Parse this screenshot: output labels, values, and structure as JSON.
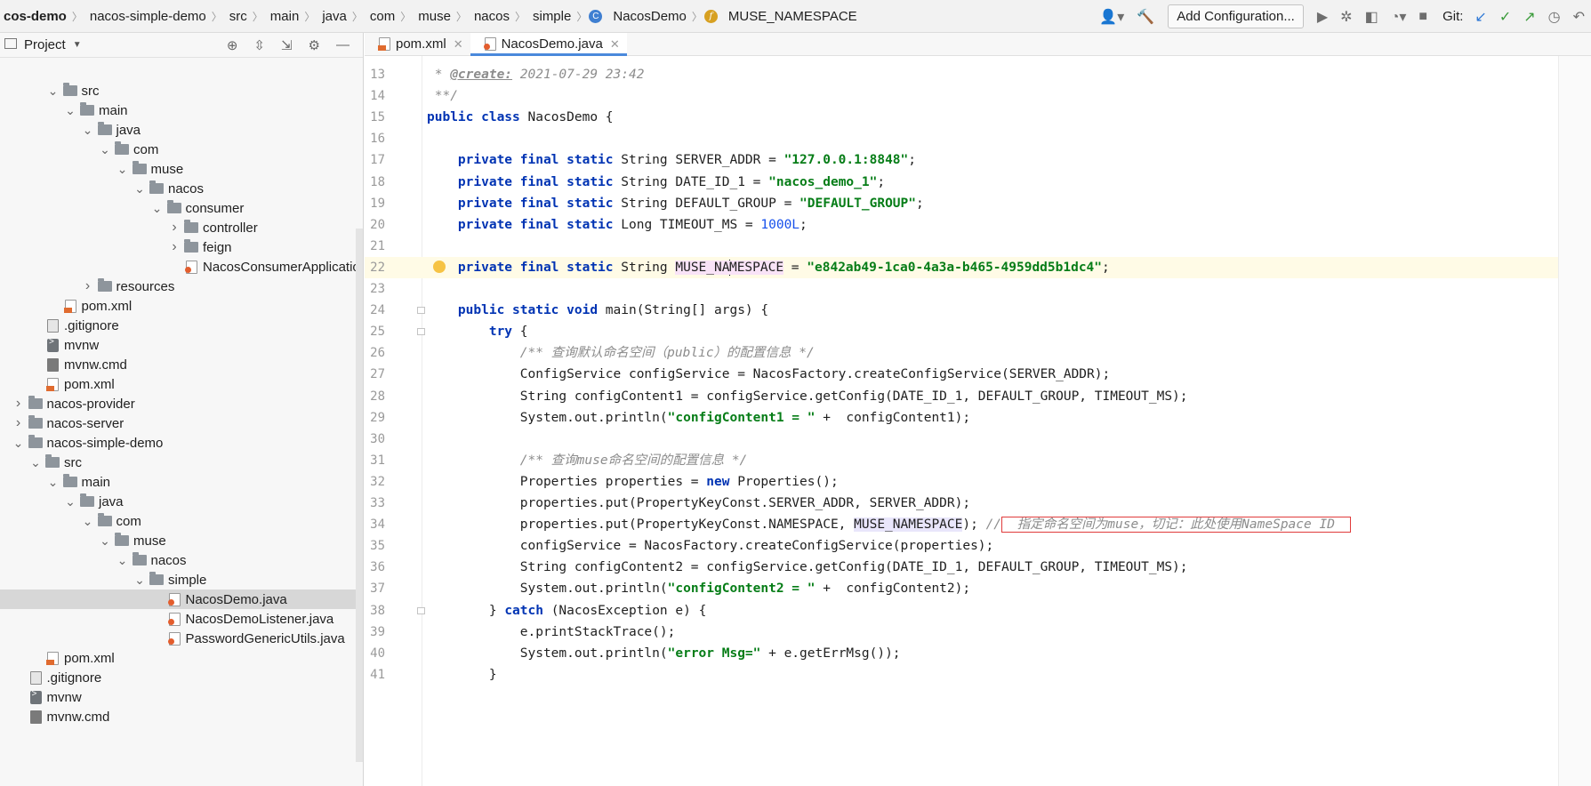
{
  "breadcrumbs": [
    {
      "label": "cos-demo"
    },
    {
      "label": "nacos-simple-demo"
    },
    {
      "label": "src"
    },
    {
      "label": "main"
    },
    {
      "label": "java"
    },
    {
      "label": "com"
    },
    {
      "label": "muse"
    },
    {
      "label": "nacos"
    },
    {
      "label": "simple"
    },
    {
      "label": "NacosDemo"
    },
    {
      "label": "MUSE_NAMESPACE"
    }
  ],
  "toolbar": {
    "add_config_label": "Add Configuration...",
    "git_label": "Git:"
  },
  "project": {
    "title": "Project"
  },
  "tree": [
    {
      "label": "src",
      "depth": 3,
      "type": "folder",
      "expanded": true
    },
    {
      "label": "main",
      "depth": 4,
      "type": "folder",
      "expanded": true
    },
    {
      "label": "java",
      "depth": 5,
      "type": "folder",
      "expanded": true
    },
    {
      "label": "com",
      "depth": 6,
      "type": "folder",
      "expanded": true
    },
    {
      "label": "muse",
      "depth": 7,
      "type": "folder",
      "expanded": true
    },
    {
      "label": "nacos",
      "depth": 8,
      "type": "folder",
      "expanded": true
    },
    {
      "label": "consumer",
      "depth": 9,
      "type": "folder",
      "expanded": true
    },
    {
      "label": "controller",
      "depth": 10,
      "type": "folder",
      "expanded": false
    },
    {
      "label": "feign",
      "depth": 10,
      "type": "folder",
      "expanded": false
    },
    {
      "label": "NacosConsumerApplicatio",
      "depth": 10,
      "type": "java"
    },
    {
      "label": "resources",
      "depth": 5,
      "type": "folder",
      "expanded": false
    },
    {
      "label": "pom.xml",
      "depth": 3,
      "type": "xml"
    },
    {
      "label": ".gitignore",
      "depth": 2,
      "type": "gen"
    },
    {
      "label": "mvnw",
      "depth": 2,
      "type": "term"
    },
    {
      "label": "mvnw.cmd",
      "depth": 2,
      "type": "cmd"
    },
    {
      "label": "pom.xml",
      "depth": 2,
      "type": "xml"
    },
    {
      "label": "nacos-provider",
      "depth": 1,
      "type": "folder",
      "expanded": false
    },
    {
      "label": "nacos-server",
      "depth": 1,
      "type": "folder",
      "expanded": false
    },
    {
      "label": "nacos-simple-demo",
      "depth": 1,
      "type": "folder",
      "expanded": true
    },
    {
      "label": "src",
      "depth": 2,
      "type": "folder",
      "expanded": true
    },
    {
      "label": "main",
      "depth": 3,
      "type": "folder",
      "expanded": true
    },
    {
      "label": "java",
      "depth": 4,
      "type": "folder",
      "expanded": true
    },
    {
      "label": "com",
      "depth": 5,
      "type": "folder",
      "expanded": true
    },
    {
      "label": "muse",
      "depth": 6,
      "type": "folder",
      "expanded": true
    },
    {
      "label": "nacos",
      "depth": 7,
      "type": "folder",
      "expanded": true
    },
    {
      "label": "simple",
      "depth": 8,
      "type": "folder",
      "expanded": true
    },
    {
      "label": "NacosDemo.java",
      "depth": 9,
      "type": "java",
      "selected": true
    },
    {
      "label": "NacosDemoListener.java",
      "depth": 9,
      "type": "java"
    },
    {
      "label": "PasswordGenericUtils.java",
      "depth": 9,
      "type": "java"
    },
    {
      "label": "pom.xml",
      "depth": 2,
      "type": "xml"
    },
    {
      "label": ".gitignore",
      "depth": 1,
      "type": "gen"
    },
    {
      "label": "mvnw",
      "depth": 1,
      "type": "term"
    },
    {
      "label": "mvnw.cmd",
      "depth": 1,
      "type": "cmd"
    }
  ],
  "tabs": [
    {
      "label": "pom.xml",
      "active": false
    },
    {
      "label": "NacosDemo.java",
      "active": true
    }
  ],
  "code_lines": [
    {
      "n": "13",
      "segs": [
        [
          " * ",
          "cm"
        ],
        [
          "@create:",
          "doc-tag"
        ],
        [
          " 2021-07-29 23:42",
          "cm"
        ]
      ]
    },
    {
      "n": "14",
      "segs": [
        [
          " **/",
          "cm"
        ]
      ]
    },
    {
      "n": "15",
      "segs": [
        [
          "public class ",
          "kw"
        ],
        [
          "NacosDemo {",
          ""
        ]
      ]
    },
    {
      "n": "16",
      "segs": []
    },
    {
      "n": "17",
      "segs": [
        [
          "    ",
          ""
        ],
        [
          "private final static ",
          "kw"
        ],
        [
          "String SERVER_ADDR = ",
          ""
        ],
        [
          "\"127.0.0.1:8848\"",
          "str"
        ],
        [
          ";",
          ""
        ]
      ]
    },
    {
      "n": "18",
      "segs": [
        [
          "    ",
          ""
        ],
        [
          "private final static ",
          "kw"
        ],
        [
          "String DATE_ID_1 = ",
          ""
        ],
        [
          "\"nacos_demo_1\"",
          "str"
        ],
        [
          ";",
          ""
        ]
      ]
    },
    {
      "n": "19",
      "segs": [
        [
          "    ",
          ""
        ],
        [
          "private final static ",
          "kw"
        ],
        [
          "String DEFAULT_GROUP = ",
          ""
        ],
        [
          "\"DEFAULT_GROUP\"",
          "str"
        ],
        [
          ";",
          ""
        ]
      ]
    },
    {
      "n": "20",
      "segs": [
        [
          "    ",
          ""
        ],
        [
          "private final static ",
          "kw"
        ],
        [
          "Long TIMEOUT_MS = ",
          ""
        ],
        [
          "1000L",
          "num"
        ],
        [
          ";",
          ""
        ]
      ]
    },
    {
      "n": "21",
      "segs": []
    },
    {
      "n": "22",
      "current": true,
      "bulb": true,
      "segs": [
        [
          "    ",
          ""
        ],
        [
          "private final static ",
          "kw"
        ],
        [
          "String ",
          ""
        ],
        [
          "MUSE_NA",
          "hl-def"
        ],
        [
          "|",
          "caret"
        ],
        [
          "MESPACE",
          "hl-def"
        ],
        [
          " = ",
          ""
        ],
        [
          "\"e842ab49-1ca0-4a3a-b465-4959dd5b1dc4\"",
          "str"
        ],
        [
          ";",
          ""
        ]
      ]
    },
    {
      "n": "23",
      "segs": []
    },
    {
      "n": "24",
      "fold": true,
      "segs": [
        [
          "    ",
          ""
        ],
        [
          "public static void ",
          "kw"
        ],
        [
          "main(String[] args) {",
          ""
        ]
      ]
    },
    {
      "n": "25",
      "fold": true,
      "segs": [
        [
          "        ",
          ""
        ],
        [
          "try ",
          "kw"
        ],
        [
          "{",
          ""
        ]
      ]
    },
    {
      "n": "26",
      "segs": [
        [
          "            ",
          ""
        ],
        [
          "/** 查询默认命名空间（public）的配置信息 */",
          "cm"
        ]
      ]
    },
    {
      "n": "27",
      "segs": [
        [
          "            ConfigService configService = NacosFactory.createConfigService(SERVER_ADDR);",
          ""
        ]
      ]
    },
    {
      "n": "28",
      "segs": [
        [
          "            String configContent1 = configService.getConfig(DATE_ID_1, DEFAULT_GROUP, TIMEOUT_MS);",
          ""
        ]
      ]
    },
    {
      "n": "29",
      "segs": [
        [
          "            System.out.println(",
          ""
        ],
        [
          "\"configContent1 = \"",
          "str"
        ],
        [
          " +  configContent1);",
          ""
        ]
      ]
    },
    {
      "n": "30",
      "segs": []
    },
    {
      "n": "31",
      "segs": [
        [
          "            ",
          ""
        ],
        [
          "/** 查询muse命名空间的配置信息 */",
          "cm"
        ]
      ]
    },
    {
      "n": "32",
      "segs": [
        [
          "            Properties properties = ",
          ""
        ],
        [
          "new ",
          "kw"
        ],
        [
          "Properties();",
          ""
        ]
      ]
    },
    {
      "n": "33",
      "segs": [
        [
          "            properties.put(PropertyKeyConst.SERVER_ADDR, SERVER_ADDR);",
          ""
        ]
      ]
    },
    {
      "n": "34",
      "segs": [
        [
          "            properties.put(PropertyKeyConst.NAMESPACE, ",
          ""
        ],
        [
          "MUSE_NAMESPACE",
          "hl-use"
        ],
        [
          "); ",
          ""
        ],
        [
          "//",
          "cm"
        ],
        [
          " 指定命名空间为muse，切记：此处使用NameSpace ID ",
          "annot-box"
        ]
      ]
    },
    {
      "n": "35",
      "segs": [
        [
          "            configService = NacosFactory.createConfigService(properties);",
          ""
        ]
      ]
    },
    {
      "n": "36",
      "segs": [
        [
          "            String configContent2 = configService.getConfig(DATE_ID_1, DEFAULT_GROUP, TIMEOUT_MS);",
          ""
        ]
      ]
    },
    {
      "n": "37",
      "segs": [
        [
          "            System.out.println(",
          ""
        ],
        [
          "\"configContent2 = \"",
          "str"
        ],
        [
          " +  configContent2);",
          ""
        ]
      ]
    },
    {
      "n": "38",
      "fold": true,
      "segs": [
        [
          "        } ",
          ""
        ],
        [
          "catch ",
          "kw"
        ],
        [
          "(NacosException e) {",
          ""
        ]
      ]
    },
    {
      "n": "39",
      "segs": [
        [
          "            e.printStackTrace();",
          ""
        ]
      ]
    },
    {
      "n": "40",
      "segs": [
        [
          "            System.out.println(",
          ""
        ],
        [
          "\"error Msg=\"",
          "str"
        ],
        [
          " + e.getErrMsg());",
          ""
        ]
      ]
    },
    {
      "n": "41",
      "segs": [
        [
          "        }",
          ""
        ]
      ]
    }
  ]
}
